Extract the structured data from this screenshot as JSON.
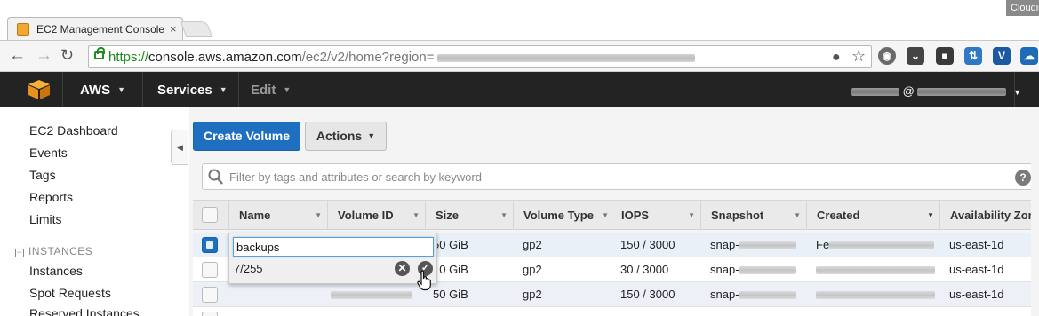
{
  "browser": {
    "tab_title": "EC2 Management Console",
    "tab_close": "×",
    "profile_label": "Cloudin",
    "url_scheme": "https://",
    "url_host": "console.aws.amazon.com",
    "url_path": "/ec2/v2/home?region="
  },
  "aws_header": {
    "brand": "AWS",
    "services": "Services",
    "edit": "Edit",
    "account_at": "@"
  },
  "sidebar": {
    "links": [
      "EC2 Dashboard",
      "Events",
      "Tags",
      "Reports",
      "Limits"
    ],
    "section_instances": "INSTANCES",
    "section_toggle": "−",
    "instance_links": [
      "Instances",
      "Spot Requests",
      "Reserved Instances"
    ]
  },
  "toolbar": {
    "create_volume": "Create Volume",
    "actions": "Actions"
  },
  "search": {
    "placeholder": "Filter by tags and attributes or search by keyword",
    "help": "?"
  },
  "table": {
    "columns": [
      "Name",
      "Volume ID",
      "Size",
      "Volume Type",
      "IOPS",
      "Snapshot",
      "Created",
      "Availability Zone"
    ],
    "rows": [
      {
        "name": "",
        "size": "50 GiB",
        "type": "gp2",
        "iops": "150 / 3000",
        "snapshot": "snap-",
        "created": "Fe",
        "az": "us-east-1d",
        "selected": true
      },
      {
        "name": "",
        "size": "10 GiB",
        "type": "gp2",
        "iops": "30 / 3000",
        "snapshot": "snap-",
        "created": "",
        "az": "us-east-1d",
        "selected": false
      },
      {
        "name": "",
        "size": "50 GiB",
        "type": "gp2",
        "iops": "150 / 3000",
        "snapshot": "snap-",
        "created": "",
        "az": "us-east-1d",
        "selected": false
      }
    ]
  },
  "editor": {
    "value": "backups",
    "counter": "7/255",
    "cancel": "✕",
    "confirm": "✓"
  },
  "colors": {
    "primary_button": "#1f6fc1",
    "header_bg": "#232323",
    "aws_orange": "#f0a830",
    "secure_green": "#1a8a1a"
  }
}
